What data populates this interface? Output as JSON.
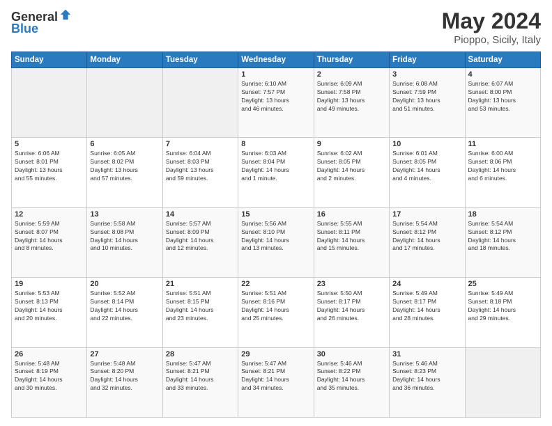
{
  "logo": {
    "general": "General",
    "blue": "Blue"
  },
  "header": {
    "title": "May 2024",
    "subtitle": "Pioppo, Sicily, Italy"
  },
  "days_of_week": [
    "Sunday",
    "Monday",
    "Tuesday",
    "Wednesday",
    "Thursday",
    "Friday",
    "Saturday"
  ],
  "weeks": [
    [
      {
        "day": "",
        "info": ""
      },
      {
        "day": "",
        "info": ""
      },
      {
        "day": "",
        "info": ""
      },
      {
        "day": "1",
        "info": "Sunrise: 6:10 AM\nSunset: 7:57 PM\nDaylight: 13 hours\nand 46 minutes."
      },
      {
        "day": "2",
        "info": "Sunrise: 6:09 AM\nSunset: 7:58 PM\nDaylight: 13 hours\nand 49 minutes."
      },
      {
        "day": "3",
        "info": "Sunrise: 6:08 AM\nSunset: 7:59 PM\nDaylight: 13 hours\nand 51 minutes."
      },
      {
        "day": "4",
        "info": "Sunrise: 6:07 AM\nSunset: 8:00 PM\nDaylight: 13 hours\nand 53 minutes."
      }
    ],
    [
      {
        "day": "5",
        "info": "Sunrise: 6:06 AM\nSunset: 8:01 PM\nDaylight: 13 hours\nand 55 minutes."
      },
      {
        "day": "6",
        "info": "Sunrise: 6:05 AM\nSunset: 8:02 PM\nDaylight: 13 hours\nand 57 minutes."
      },
      {
        "day": "7",
        "info": "Sunrise: 6:04 AM\nSunset: 8:03 PM\nDaylight: 13 hours\nand 59 minutes."
      },
      {
        "day": "8",
        "info": "Sunrise: 6:03 AM\nSunset: 8:04 PM\nDaylight: 14 hours\nand 1 minute."
      },
      {
        "day": "9",
        "info": "Sunrise: 6:02 AM\nSunset: 8:05 PM\nDaylight: 14 hours\nand 2 minutes."
      },
      {
        "day": "10",
        "info": "Sunrise: 6:01 AM\nSunset: 8:05 PM\nDaylight: 14 hours\nand 4 minutes."
      },
      {
        "day": "11",
        "info": "Sunrise: 6:00 AM\nSunset: 8:06 PM\nDaylight: 14 hours\nand 6 minutes."
      }
    ],
    [
      {
        "day": "12",
        "info": "Sunrise: 5:59 AM\nSunset: 8:07 PM\nDaylight: 14 hours\nand 8 minutes."
      },
      {
        "day": "13",
        "info": "Sunrise: 5:58 AM\nSunset: 8:08 PM\nDaylight: 14 hours\nand 10 minutes."
      },
      {
        "day": "14",
        "info": "Sunrise: 5:57 AM\nSunset: 8:09 PM\nDaylight: 14 hours\nand 12 minutes."
      },
      {
        "day": "15",
        "info": "Sunrise: 5:56 AM\nSunset: 8:10 PM\nDaylight: 14 hours\nand 13 minutes."
      },
      {
        "day": "16",
        "info": "Sunrise: 5:55 AM\nSunset: 8:11 PM\nDaylight: 14 hours\nand 15 minutes."
      },
      {
        "day": "17",
        "info": "Sunrise: 5:54 AM\nSunset: 8:12 PM\nDaylight: 14 hours\nand 17 minutes."
      },
      {
        "day": "18",
        "info": "Sunrise: 5:54 AM\nSunset: 8:12 PM\nDaylight: 14 hours\nand 18 minutes."
      }
    ],
    [
      {
        "day": "19",
        "info": "Sunrise: 5:53 AM\nSunset: 8:13 PM\nDaylight: 14 hours\nand 20 minutes."
      },
      {
        "day": "20",
        "info": "Sunrise: 5:52 AM\nSunset: 8:14 PM\nDaylight: 14 hours\nand 22 minutes."
      },
      {
        "day": "21",
        "info": "Sunrise: 5:51 AM\nSunset: 8:15 PM\nDaylight: 14 hours\nand 23 minutes."
      },
      {
        "day": "22",
        "info": "Sunrise: 5:51 AM\nSunset: 8:16 PM\nDaylight: 14 hours\nand 25 minutes."
      },
      {
        "day": "23",
        "info": "Sunrise: 5:50 AM\nSunset: 8:17 PM\nDaylight: 14 hours\nand 26 minutes."
      },
      {
        "day": "24",
        "info": "Sunrise: 5:49 AM\nSunset: 8:17 PM\nDaylight: 14 hours\nand 28 minutes."
      },
      {
        "day": "25",
        "info": "Sunrise: 5:49 AM\nSunset: 8:18 PM\nDaylight: 14 hours\nand 29 minutes."
      }
    ],
    [
      {
        "day": "26",
        "info": "Sunrise: 5:48 AM\nSunset: 8:19 PM\nDaylight: 14 hours\nand 30 minutes."
      },
      {
        "day": "27",
        "info": "Sunrise: 5:48 AM\nSunset: 8:20 PM\nDaylight: 14 hours\nand 32 minutes."
      },
      {
        "day": "28",
        "info": "Sunrise: 5:47 AM\nSunset: 8:21 PM\nDaylight: 14 hours\nand 33 minutes."
      },
      {
        "day": "29",
        "info": "Sunrise: 5:47 AM\nSunset: 8:21 PM\nDaylight: 14 hours\nand 34 minutes."
      },
      {
        "day": "30",
        "info": "Sunrise: 5:46 AM\nSunset: 8:22 PM\nDaylight: 14 hours\nand 35 minutes."
      },
      {
        "day": "31",
        "info": "Sunrise: 5:46 AM\nSunset: 8:23 PM\nDaylight: 14 hours\nand 36 minutes."
      },
      {
        "day": "",
        "info": ""
      }
    ]
  ]
}
